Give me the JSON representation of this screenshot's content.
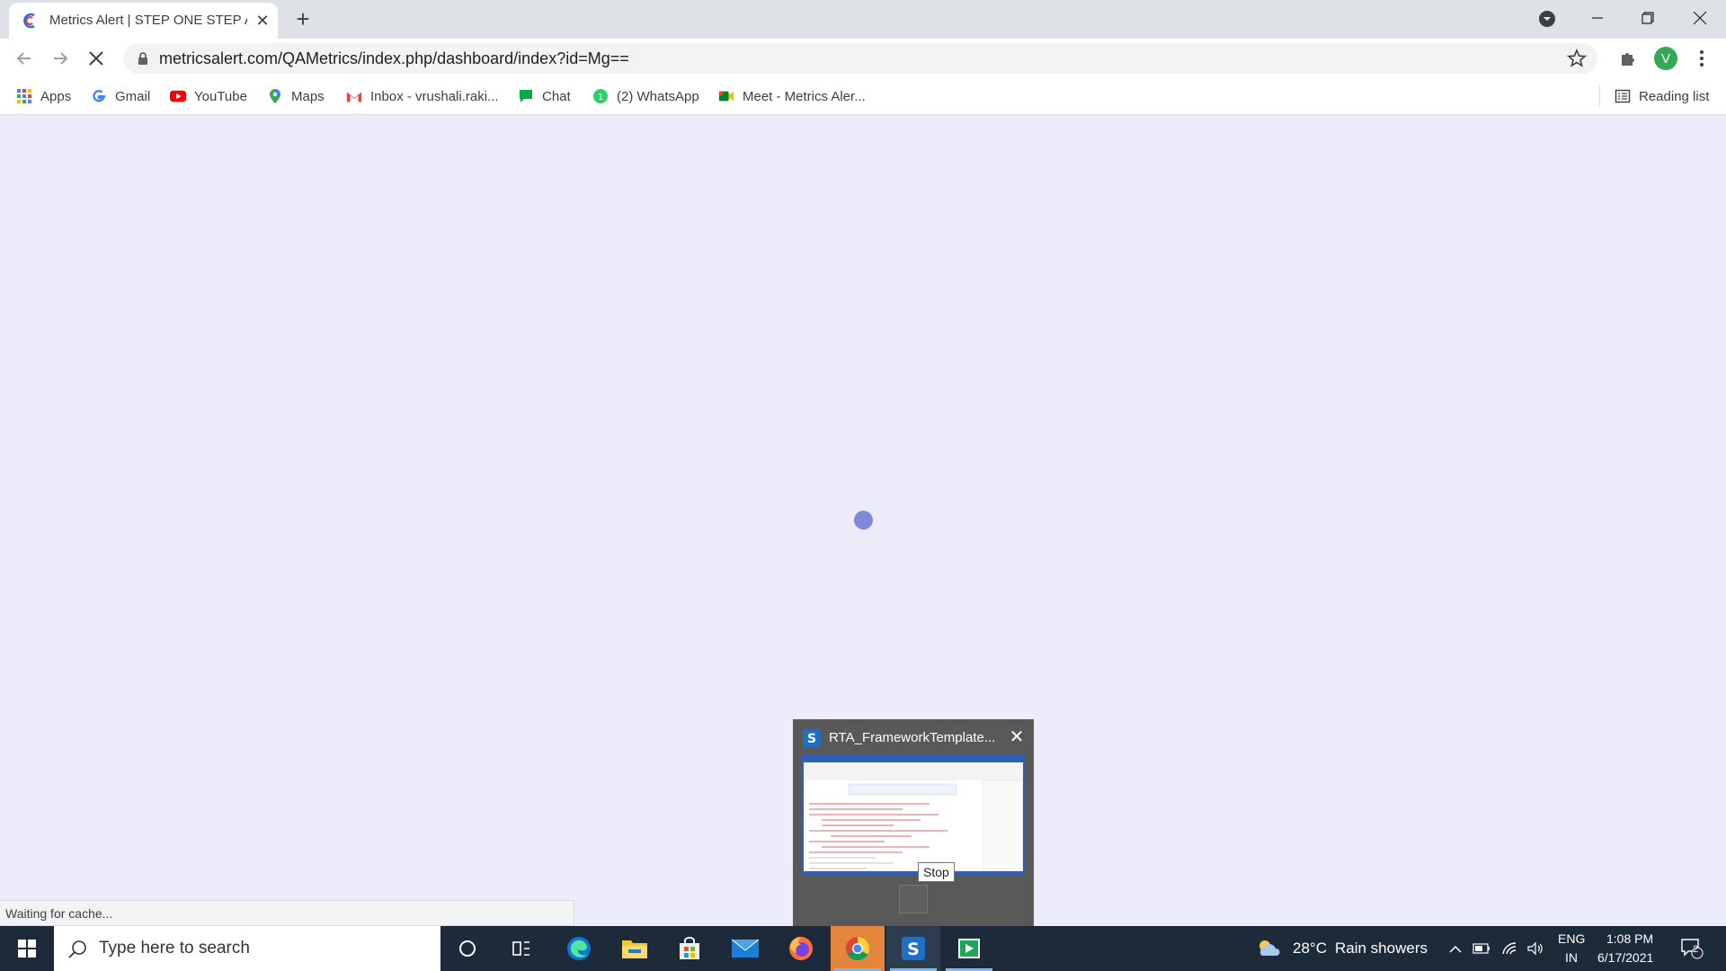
{
  "browser": {
    "tab": {
      "title": "Metrics Alert | STEP ONE STEP AH"
    },
    "address": {
      "url": "metricsalert.com/QAMetrics/index.php/dashboard/index?id=Mg=="
    },
    "profile_initial": "V",
    "bookmarks": [
      {
        "label": "Apps",
        "icon": "apps-grid-icon"
      },
      {
        "label": "Gmail",
        "icon": "google-icon"
      },
      {
        "label": "YouTube",
        "icon": "youtube-icon"
      },
      {
        "label": "Maps",
        "icon": "maps-pin-icon"
      },
      {
        "label": "Inbox - vrushali.raki...",
        "icon": "gmail-icon"
      },
      {
        "label": "Chat",
        "icon": "chat-icon"
      },
      {
        "label": "(2) WhatsApp",
        "icon": "whatsapp-icon"
      },
      {
        "label": "Meet - Metrics Aler...",
        "icon": "meet-icon"
      }
    ],
    "reading_list": "Reading list",
    "status": "Waiting for cache..."
  },
  "preview": {
    "title": "RTA_FrameworkTemplate...",
    "tooltip": "Stop"
  },
  "taskbar": {
    "search_placeholder": "Type here to search",
    "weather": {
      "temp": "28°C",
      "condition": "Rain showers"
    },
    "lang_top": "ENG",
    "lang_bottom": "IN",
    "time": "1:08 PM",
    "date": "6/17/2021",
    "notifications": "2"
  },
  "colors": {
    "page_bg": "#ececfb",
    "spinner": "#8088d8",
    "taskbar": "#1d2a3a",
    "active_app": "#e1863a"
  }
}
